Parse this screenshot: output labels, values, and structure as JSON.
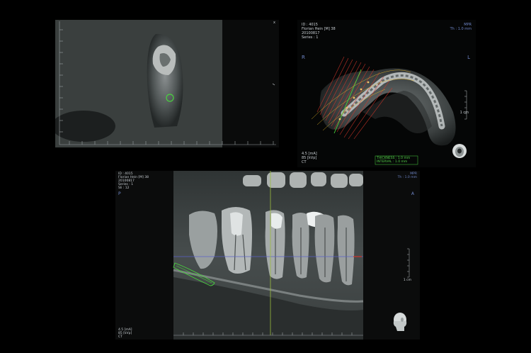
{
  "axial": {
    "id": "ID : 4015",
    "patient": "Florian Hein [M] 38",
    "date": "20100817",
    "series": "Series : 1",
    "view_mode": "MPR",
    "thickness": "Th : 1.0 mm",
    "orient_left": "R",
    "orient_right": "L",
    "scale_label": "1 cm",
    "ma": "4.5 [mA]",
    "kv": "85 [kVp]",
    "modality": "CT",
    "thickness_line": "THICKNESS : 1.0 mm",
    "interval_line": "INTERVAL : 1.0 mm"
  },
  "panoramic": {
    "id": "ID : 4015",
    "patient": "Florian Hein [M] 38",
    "date": "20100817",
    "series": "Series : 1",
    "slice": "Sli : 12",
    "view_mode": "MPR",
    "thickness": "Th : 1.0 mm",
    "orient_left": "P",
    "orient_right": "A",
    "scale_label": "1 cm",
    "ma": "4.5 [mA]",
    "kv": "85 [kVp]",
    "modality": "CT"
  },
  "cross_section": {
    "corner_marker": "x"
  }
}
